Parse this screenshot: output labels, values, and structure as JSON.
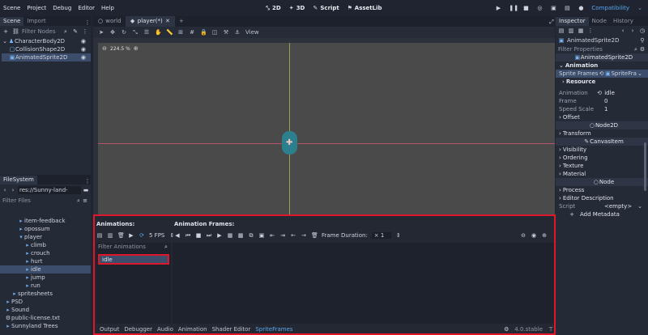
{
  "menu": [
    "Scene",
    "Project",
    "Debug",
    "Editor",
    "Help"
  ],
  "workspaces": [
    {
      "label": "2D",
      "icon": "2d-icon",
      "active": true
    },
    {
      "label": "3D",
      "icon": "3d-icon"
    },
    {
      "label": "Script",
      "icon": "script-icon"
    },
    {
      "label": "AssetLib",
      "icon": "assetlib-icon"
    }
  ],
  "renderer": "Compatibility",
  "scene_dock": {
    "tabs": [
      "Scene",
      "Import"
    ],
    "filter_placeholder": "Filter Nodes",
    "nodes": [
      {
        "label": "CharacterBody2D",
        "indent": 0
      },
      {
        "label": "CollisionShape2D",
        "indent": 1
      },
      {
        "label": "AnimatedSprite2D",
        "indent": 1,
        "selected": true
      }
    ]
  },
  "filesystem": {
    "title": "FileSystem",
    "path": "res://Sunny-land-assets-file",
    "filter_placeholder": "Filter Files",
    "items": [
      {
        "label": "item-feedback",
        "indent": 2
      },
      {
        "label": "opossum",
        "indent": 2
      },
      {
        "label": "player",
        "indent": 2
      },
      {
        "label": "climb",
        "indent": 3
      },
      {
        "label": "crouch",
        "indent": 3
      },
      {
        "label": "hurt",
        "indent": 3
      },
      {
        "label": "idle",
        "indent": 3,
        "selected": true
      },
      {
        "label": "jump",
        "indent": 3
      },
      {
        "label": "run",
        "indent": 3
      },
      {
        "label": "spritesheets",
        "indent": 1
      },
      {
        "label": "PSD",
        "indent": 0
      },
      {
        "label": "Sound",
        "indent": 0
      },
      {
        "label": "public-license.txt",
        "indent": 0
      },
      {
        "label": "Sunnyland Trees",
        "indent": 0
      }
    ]
  },
  "editor_tabs": [
    "world",
    "player(*)"
  ],
  "toolbar": {
    "view_label": "View"
  },
  "viewport": {
    "zoom": "224.5 %"
  },
  "sprite_frames": {
    "animations_title": "Animations:",
    "frames_title": "Animation Frames:",
    "fps": "5 FPS",
    "frame_duration_label": "Frame Duration:",
    "frame_duration_value": "1",
    "filter_placeholder": "Filter Animations",
    "animations": [
      "idle"
    ]
  },
  "bottom_tabs": [
    "Output",
    "Debugger",
    "Audio",
    "Animation",
    "Shader Editor",
    "SpriteFrames"
  ],
  "version": "4.0.stable",
  "inspector": {
    "tabs": [
      "Inspector",
      "Node",
      "History"
    ],
    "node_name": "AnimatedSprite2D",
    "filter_placeholder": "Filter Properties",
    "class": "AnimatedSprite2D",
    "animation_section": "Animation",
    "sprite_frames_label": "Sprite Frames",
    "sprite_frames_value": "SpriteFra",
    "resource_label": "Resource",
    "animation_label": "Animation",
    "animation_value": "idle",
    "frame_label": "Frame",
    "frame_value": "0",
    "speed_label": "Speed Scale",
    "speed_value": "1",
    "offset_label": "Offset",
    "node2d": "Node2D",
    "transform": "Transform",
    "canvasitem": "CanvasItem",
    "visibility": "Visibility",
    "ordering": "Ordering",
    "texture": "Texture",
    "material": "Material",
    "node": "Node",
    "process": "Process",
    "editor_description": "Editor Description",
    "script_label": "Script",
    "script_value": "<empty>",
    "add_metadata": "Add Metadata"
  }
}
